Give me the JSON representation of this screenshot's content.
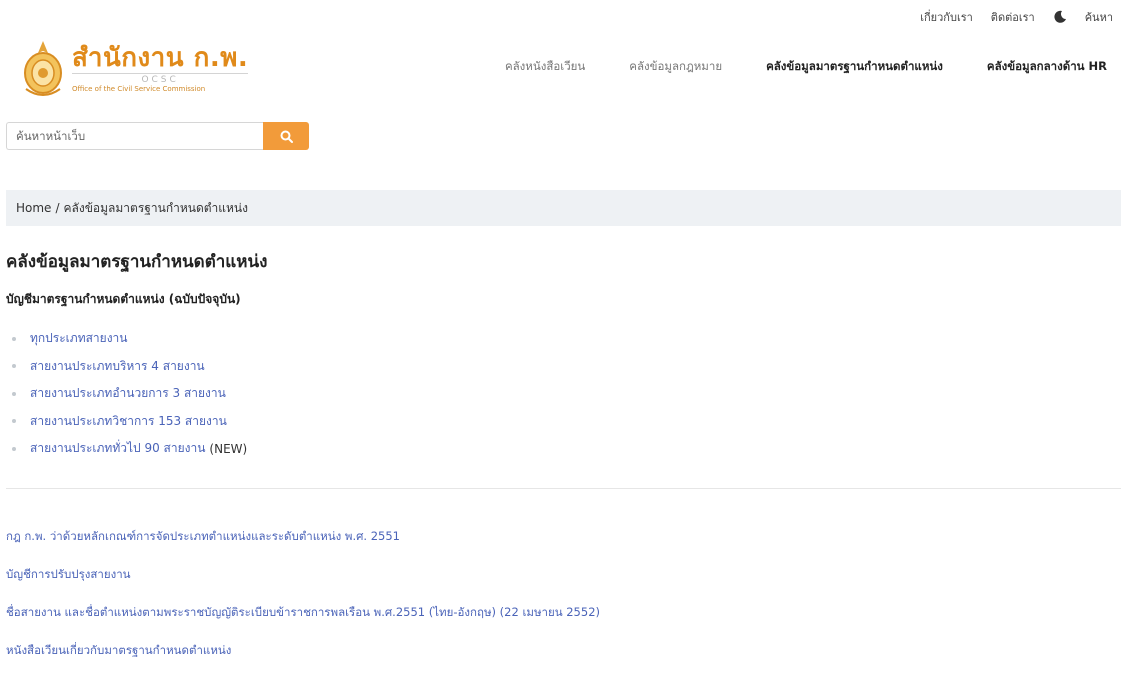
{
  "topbar": {
    "about": "เกี่ยวกับเรา",
    "contact": "ติดต่อเรา",
    "search": "ค้นหา"
  },
  "logo": {
    "main": "สำนักงาน ก.พ.",
    "sub": "OCSC",
    "en": "Office of the Civil Service Commission"
  },
  "nav": {
    "items": [
      {
        "label": "คลังหนังสือเวียน"
      },
      {
        "label": "คลังข้อมูลกฎหมาย"
      },
      {
        "label": "คลังข้อมูลมาตรฐานกำหนดตำแหน่ง"
      },
      {
        "label": "คลังข้อมูลกลางด้าน HR"
      }
    ]
  },
  "search": {
    "placeholder": "ค้นหาหน้าเว็บ"
  },
  "breadcrumb": {
    "home": "Home",
    "separator": "/",
    "current": "คลังข้อมูลมาตรฐานกำหนดตำแหน่ง"
  },
  "main": {
    "title": "คลังข้อมูลมาตรฐานกำหนดตำแหน่ง",
    "section_title": "บัญชีมาตรฐานกำหนดตำแหน่ง (ฉบับปัจจุบัน)",
    "list": [
      {
        "label": "ทุกประเภทสายงาน",
        "suffix": ""
      },
      {
        "label": "สายงานประเภทบริหาร 4 สายงาน",
        "suffix": ""
      },
      {
        "label": "สายงานประเภทอำนวยการ 3 สายงาน",
        "suffix": ""
      },
      {
        "label": "สายงานประเภทวิชาการ 153 สายงาน",
        "suffix": ""
      },
      {
        "label": "สายงานประเภททั่วไป 90 สายงาน",
        "suffix": "(NEW)"
      }
    ],
    "links": [
      {
        "label": "กฎ ก.พ. ว่าด้วยหลักเกณฑ์การจัดประเภทตำแหน่งและระดับตำแหน่ง พ.ศ. 2551"
      },
      {
        "label": "บัญชีการปรับปรุงสายงาน"
      },
      {
        "label": "ชื่อสายงาน และชื่อตำแหน่งตามพระราชบัญญัติระเบียบข้าราชการพลเรือน พ.ศ.2551 (ไทย-อังกฤษ) (22 เมษายน 2552)"
      },
      {
        "label": "หนังสือเวียนเกี่ยวกับมาตรฐานกำหนดตำแหน่ง"
      }
    ]
  },
  "colors": {
    "accent": "#f29b3a",
    "link": "#4a63b8",
    "brand": "#e08a1a"
  }
}
